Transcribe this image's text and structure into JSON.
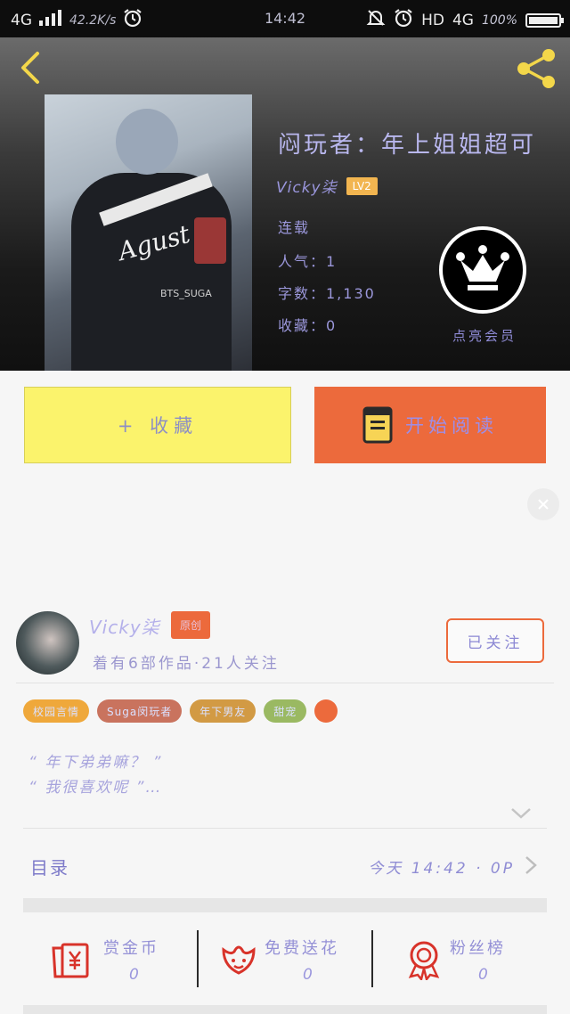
{
  "status_bar": {
    "network": "4G",
    "speed": "42.2K/s",
    "time": "14:42",
    "hd": "HD",
    "network_right": "4G",
    "battery": "100%",
    "battery_level": 1.0
  },
  "book": {
    "title": "闷玩者：年上姐姐超可",
    "author": "Vicky柒",
    "level": "LV2",
    "status": "连载",
    "popularity": "人气：1",
    "word_count": "字数：1,130",
    "favorites": "收藏：0",
    "cover_caption": "BTS_SUGA",
    "cover_signature": "Agust"
  },
  "vip": {
    "label": "点亮会员"
  },
  "actions": {
    "collect_label": "+ 收藏",
    "read_label": "开始阅读"
  },
  "author_card": {
    "name": "Vicky柒",
    "badge": "原创",
    "info": "着有6部作品·21人关注",
    "follow_label": "已关注"
  },
  "tags": [
    {
      "label": "校园言情",
      "color": "#efa83b"
    },
    {
      "label": "Suga闵玩者",
      "color": "#c9735e"
    },
    {
      "label": "年下男友",
      "color": "#d29a44"
    },
    {
      "label": "甜宠",
      "color": "#9ab962"
    }
  ],
  "quote": {
    "line1": "“ 年下弟弟嘛？ ”",
    "line2": "“ 我很喜欢呢 ”…"
  },
  "toc": {
    "label": "目录",
    "update": "今天 14:42 · 0P"
  },
  "bottom": {
    "reward": {
      "label": "赏金币",
      "count": "0"
    },
    "flower": {
      "label": "免费送花",
      "count": "0"
    },
    "fans": {
      "label": "粉丝榜",
      "count": "0"
    }
  },
  "colors": {
    "accent_orange": "#ec6a3c",
    "collect_yellow": "#fbf36c",
    "text_purple": "#9b97db",
    "icon_red": "#d8332a"
  },
  "icons": {
    "back": "chevron-left-icon",
    "share": "share-icon",
    "vip": "crown-icon",
    "read": "book-icon",
    "close": "close-icon",
    "expand": "chevron-down-icon",
    "toc": "chevron-right-icon",
    "reward": "coin-envelope-icon",
    "flower": "flower-icon",
    "fans": "ribbon-medal-icon"
  }
}
